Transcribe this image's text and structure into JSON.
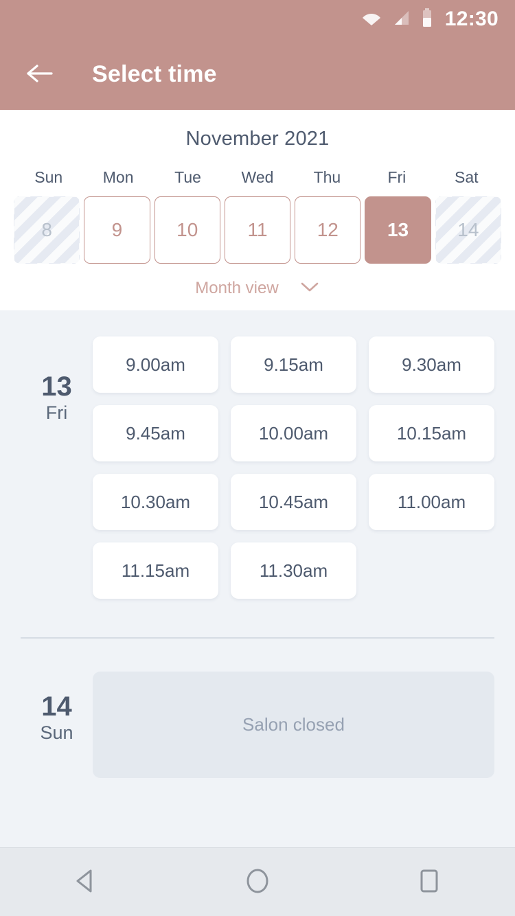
{
  "theme": {
    "accent": "#c2938d",
    "accent_muted": "#cfa6a0",
    "page_bg": "#f0f3f7",
    "panel_bg": "#ffffff",
    "text_dark": "#4e5a6e",
    "text_muted": "#96a1b2",
    "disabled_bg": "#eaeef4",
    "closed_card_bg": "#e4e9ef",
    "navbar_bg": "#e6e9ed"
  },
  "statusbar": {
    "time": "12:30",
    "icons": [
      "wifi-icon",
      "signal-icon",
      "battery-icon"
    ]
  },
  "appbar": {
    "back_icon": "arrow-left-icon",
    "title": "Select time"
  },
  "calendar": {
    "month_title": "November 2021",
    "weekdays": [
      "Sun",
      "Mon",
      "Tue",
      "Wed",
      "Thu",
      "Fri",
      "Sat"
    ],
    "days": [
      {
        "num": "8",
        "state": "disabled"
      },
      {
        "num": "9",
        "state": "available"
      },
      {
        "num": "10",
        "state": "available"
      },
      {
        "num": "11",
        "state": "available"
      },
      {
        "num": "12",
        "state": "available"
      },
      {
        "num": "13",
        "state": "selected"
      },
      {
        "num": "14",
        "state": "disabled"
      }
    ],
    "view_toggle": {
      "label": "Month view",
      "icon": "chevron-down-icon"
    }
  },
  "schedule": [
    {
      "day_number": "13",
      "day_name": "Fri",
      "status": "open",
      "slots": [
        "9.00am",
        "9.15am",
        "9.30am",
        "9.45am",
        "10.00am",
        "10.15am",
        "10.30am",
        "10.45am",
        "11.00am",
        "11.15am",
        "11.30am"
      ]
    },
    {
      "day_number": "14",
      "day_name": "Sun",
      "status": "closed",
      "closed_message": "Salon closed",
      "slots": []
    }
  ],
  "navbar": {
    "back_label": "back-triangle-icon",
    "home_label": "home-circle-icon",
    "recents_label": "recents-square-icon"
  }
}
